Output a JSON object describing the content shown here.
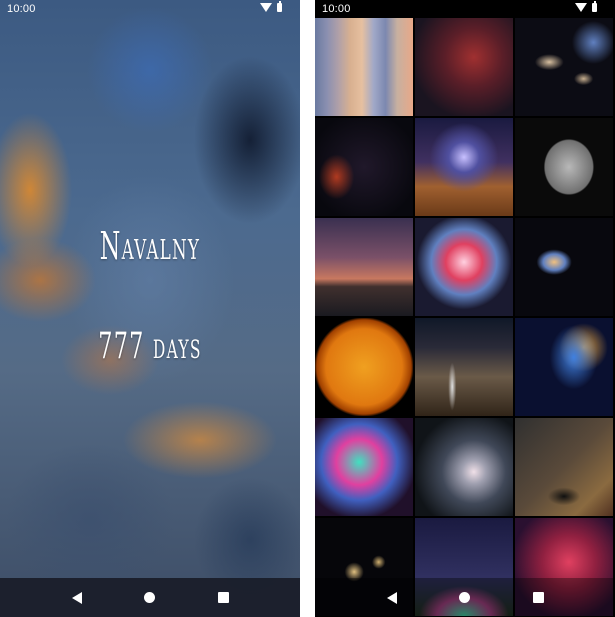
{
  "left_screen": {
    "status_time": "10:00",
    "title": "Navalny",
    "days": "777 days",
    "nav": {
      "back": "back-icon",
      "home": "home-icon",
      "recents": "recents-icon"
    }
  },
  "right_screen": {
    "status_time": "10:00",
    "thumbnails": [
      {
        "name": "thumb-color-strips",
        "bg": "linear-gradient(90deg,#6a7aa0 0%,#8a8fb0 12%,#b0a0a8 24%,#d8b090 36%,#e6c0a0 48%,#a0a8c8 60%,#7c88b0 72%,#c8b0a0 84%,#e8a888 100%)"
      },
      {
        "name": "thumb-red-nebula",
        "bg": "radial-gradient(circle at 60% 40%,#a03030 0%,#5a1e28 35%,#1a1420 75%)"
      },
      {
        "name": "thumb-galaxies-pair",
        "bg": "radial-gradient(ellipse 18px 10px at 35% 45%,#d8c0a0,transparent 80%),radial-gradient(ellipse 12px 8px at 70% 62%,#c8b090,transparent 80%),radial-gradient(circle at 80% 25%,#6080c0,transparent 20%),#0c0c14"
      },
      {
        "name": "thumb-dark-red-nebula",
        "bg": "radial-gradient(ellipse 22px 28px at 22% 60%,#b03a20,transparent 80%),radial-gradient(circle at 50% 50%,#20182a,#08080e 80%)"
      },
      {
        "name": "thumb-milky-way-hiker",
        "bg": "radial-gradient(circle at 50% 40%,#c8c0ff 0%,#5050a0 20%,transparent 45%),linear-gradient(180deg,#1a1a40 0%,#403060 45%,#a06030 70%,#6a3a18 100%)"
      },
      {
        "name": "thumb-moon-hyperion",
        "bg": "radial-gradient(ellipse 34px 38px at 55% 50%,#b8b8b8,#707070 70%,transparent 74%),#0a0a0a"
      },
      {
        "name": "thumb-sunset-palms",
        "bg": "linear-gradient(180deg,#3a3050 0%,#7a5068 40%,#c87860 62%,#40302e 70%,#1a1a20 100%)"
      },
      {
        "name": "thumb-planetary-nebula",
        "bg": "radial-gradient(circle at 50% 45%,#ffd0e0 0%,#e04060 25%,#6080c0 45%,#1a1a30 65%),#0c0c18"
      },
      {
        "name": "thumb-spiral-galaxy",
        "bg": "radial-gradient(ellipse 22px 16px at 40% 45%,#f0c080,#6080c0 50%,transparent 80%),#08080e"
      },
      {
        "name": "thumb-sun-chromosphere",
        "bg": "radial-gradient(circle at 50% 50%,#f0a020 0%,#e07810 55%,#a04000 68%,#000 72%)"
      },
      {
        "name": "thumb-waterfall-cliff",
        "bg": "radial-gradient(ellipse 5px 30px at 38% 70%,#e0e0e0,transparent 80%),linear-gradient(180deg,#101828 0%,#2a2a38 30%,#6a5a48 60%,#302418 100%)"
      },
      {
        "name": "thumb-blue-veil-nebula",
        "bg": "radial-gradient(ellipse 30px 40px at 60% 40%,#4080e0,transparent 80%),radial-gradient(circle at 70% 30%,#e0a040,transparent 25%),#0a1030"
      },
      {
        "name": "thumb-colorful-nebula",
        "bg": "radial-gradient(circle at 45% 45%,#40e0c0 0%,#e040a0 30%,#4060c0 50%,#20102a 75%)"
      },
      {
        "name": "thumb-dark-swirl-nebula",
        "bg": "radial-gradient(circle at 60% 55%,#f0e0e8 0%,#a0a0b0 15%,#404858 40%,#101418 75%)"
      },
      {
        "name": "thumb-meteor-tree",
        "bg": "radial-gradient(ellipse 18px 10px at 50% 80%,#101010,transparent 90%),linear-gradient(135deg,#303030 0%,#5a4a3a 50%,#8a6a40 80%,#503020 100%)"
      },
      {
        "name": "thumb-galaxy-cluster",
        "bg": "radial-gradient(circle at 40% 55%,#e0c080,transparent 12%),radial-gradient(circle at 65% 45%,#d0b070,transparent 8%),#06060a"
      },
      {
        "name": "thumb-aurora-arc",
        "bg": "radial-gradient(ellipse 60px 40px at 50% 100%,#40d0a0,#a04080 45%,transparent 75%),linear-gradient(180deg,#1a1a40 0%,#303060 60%,#203020 100%)"
      },
      {
        "name": "thumb-pink-nebula",
        "bg": "radial-gradient(circle at 55% 45%,#e04060 0%,#902040 35%,#2a1030 75%)"
      }
    ]
  }
}
